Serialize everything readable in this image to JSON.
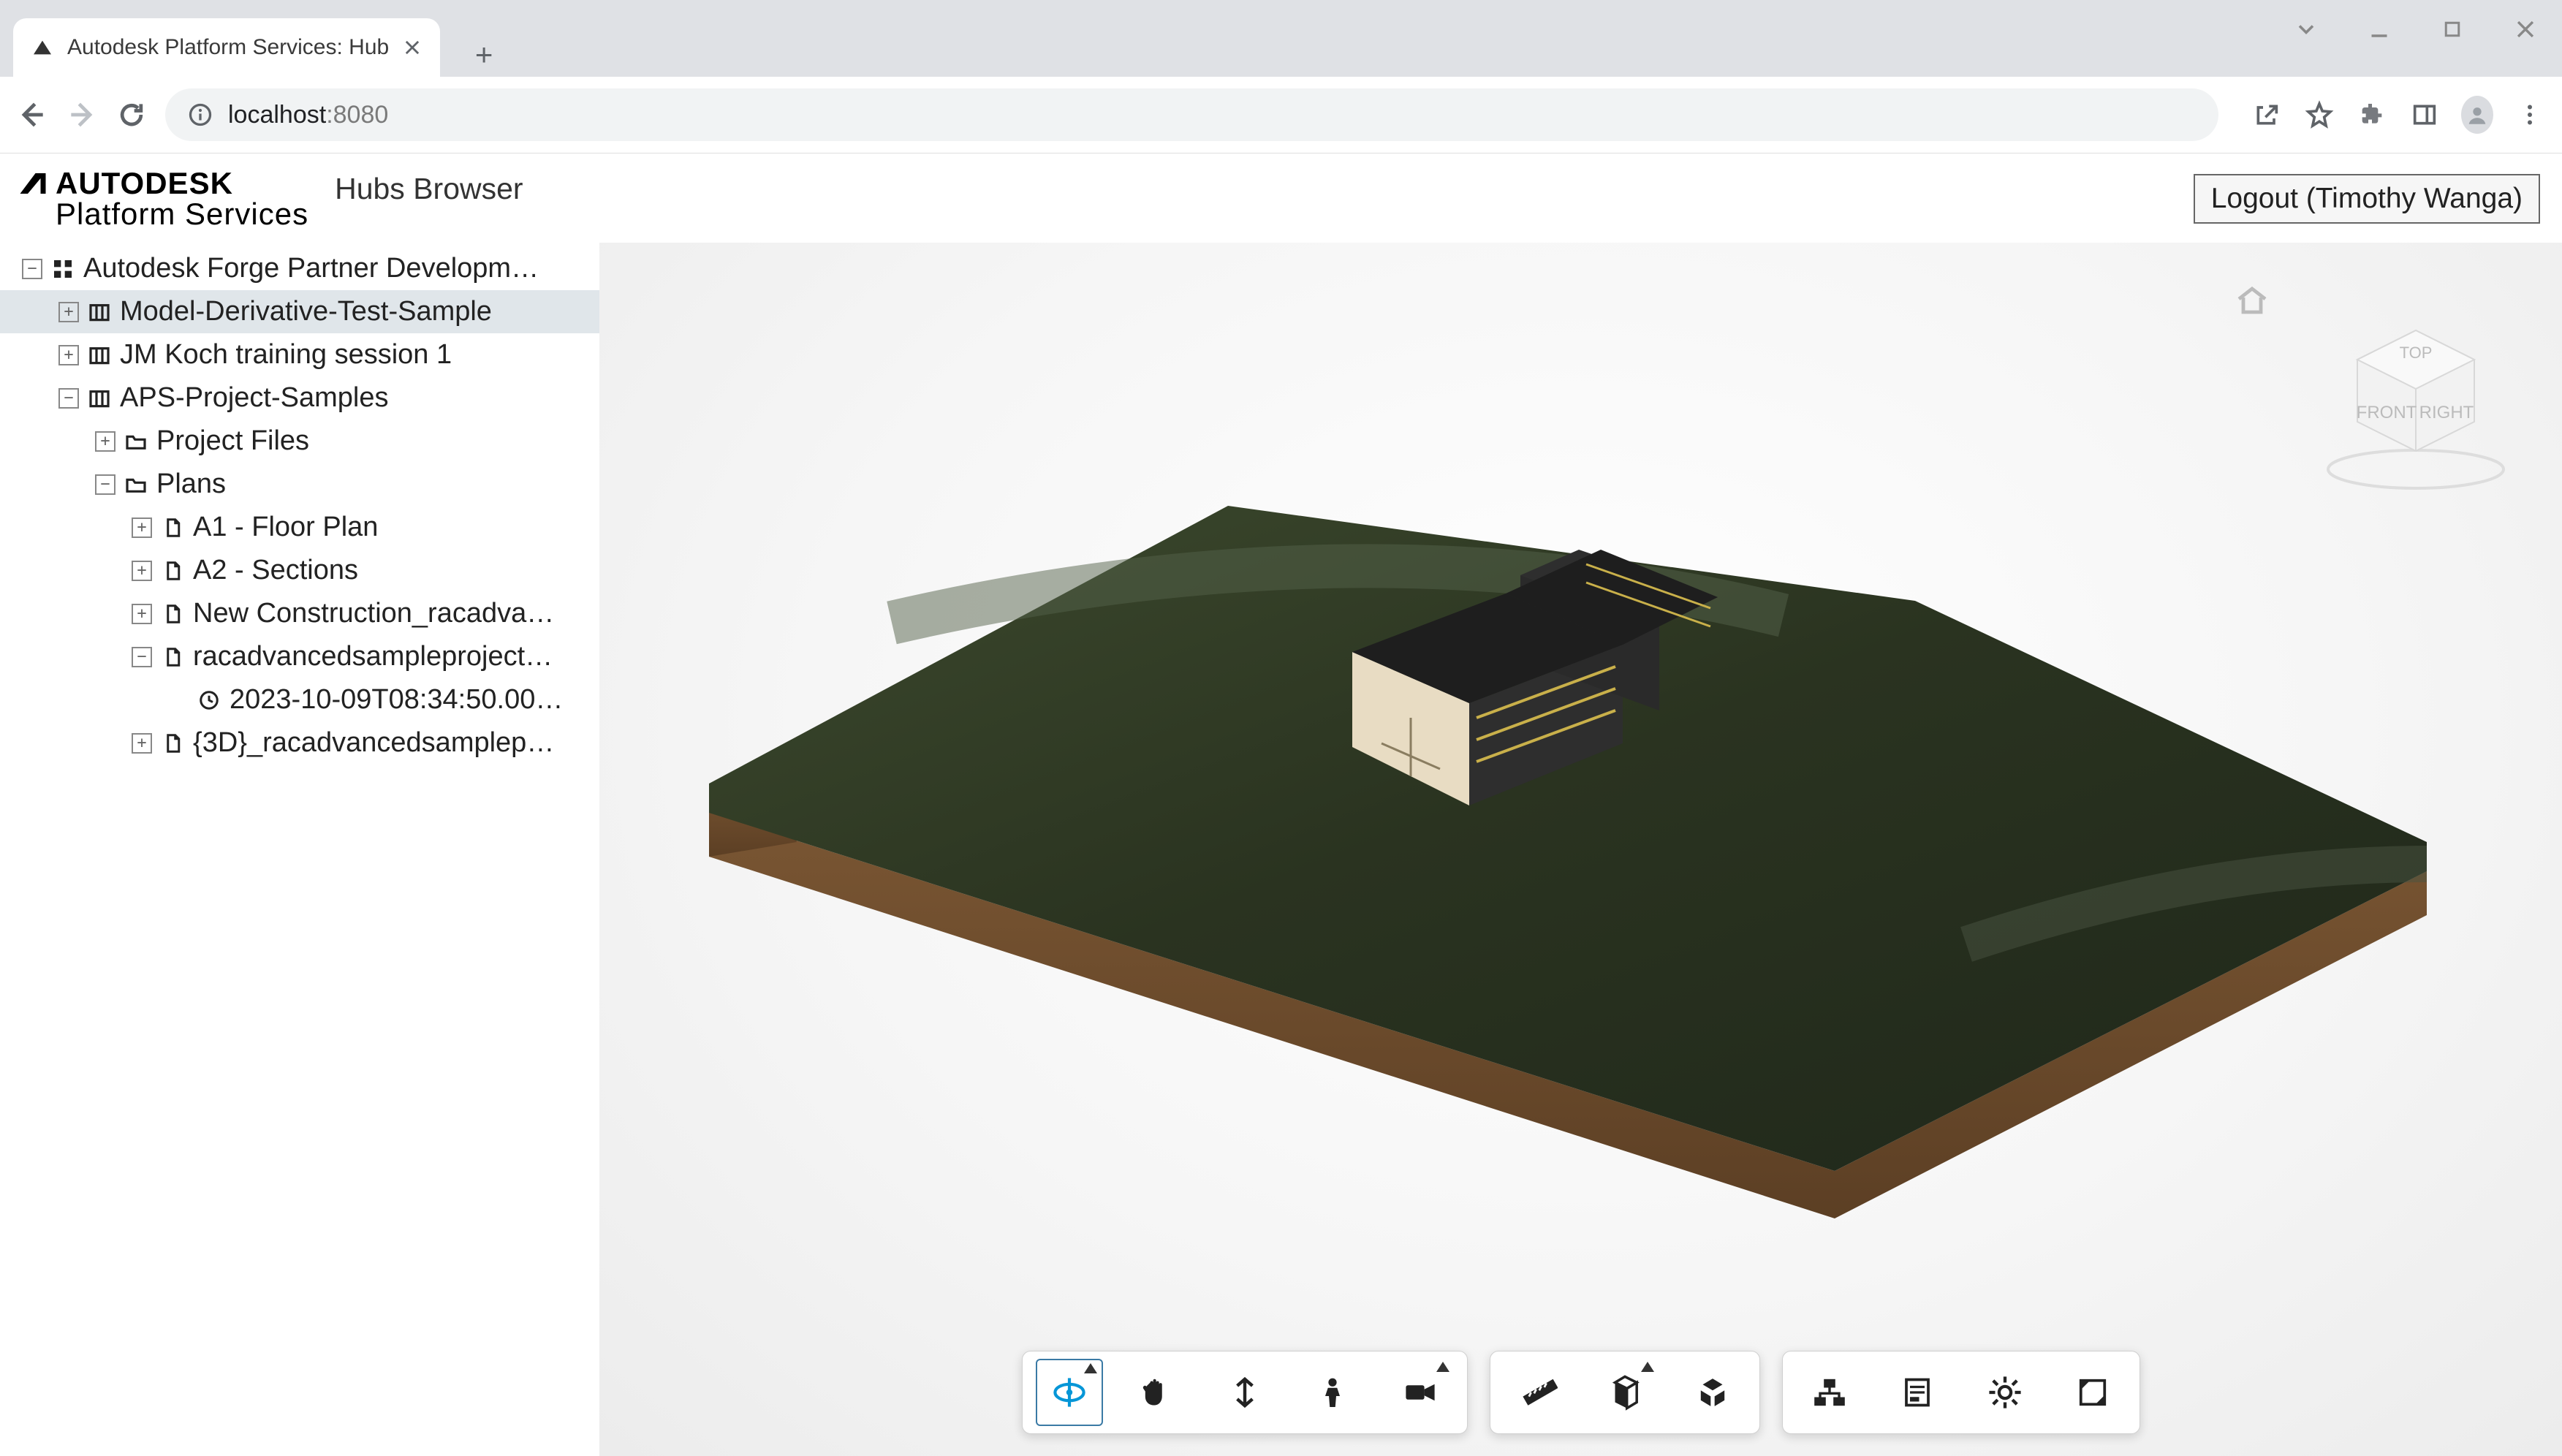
{
  "browser": {
    "tab_title": "Autodesk Platform Services: Hub",
    "url_host": "localhost",
    "url_port": ":8080"
  },
  "header": {
    "brand_line1": "AUTODESK",
    "brand_line2": "Platform Services",
    "title": "Hubs Browser",
    "logout_label": "Logout (Timothy Wanga)"
  },
  "tree": [
    {
      "depth": 0,
      "toggle": "minus",
      "icon": "hub",
      "label": "Autodesk Forge Partner Developm…",
      "sel": false
    },
    {
      "depth": 1,
      "toggle": "plus",
      "icon": "project",
      "label": "Model-Derivative-Test-Sample",
      "sel": true
    },
    {
      "depth": 1,
      "toggle": "plus",
      "icon": "project",
      "label": "JM Koch training session 1",
      "sel": false
    },
    {
      "depth": 1,
      "toggle": "minus",
      "icon": "project",
      "label": "APS-Project-Samples",
      "sel": false
    },
    {
      "depth": 2,
      "toggle": "plus",
      "icon": "folder",
      "label": "Project Files",
      "sel": false
    },
    {
      "depth": 2,
      "toggle": "minus",
      "icon": "folder",
      "label": "Plans",
      "sel": false
    },
    {
      "depth": 3,
      "toggle": "plus",
      "icon": "file",
      "label": "A1 - Floor Plan",
      "sel": false
    },
    {
      "depth": 3,
      "toggle": "plus",
      "icon": "file",
      "label": "A2 - Sections",
      "sel": false
    },
    {
      "depth": 3,
      "toggle": "plus",
      "icon": "file",
      "label": "New Construction_racadva…",
      "sel": false
    },
    {
      "depth": 3,
      "toggle": "minus",
      "icon": "file",
      "label": "racadvancedsampleproject…",
      "sel": false
    },
    {
      "depth": 4,
      "toggle": "none",
      "icon": "clock",
      "label": "2023-10-09T08:34:50.00…",
      "sel": false
    },
    {
      "depth": 3,
      "toggle": "plus",
      "icon": "file",
      "label": "{3D}_racadvancedsamplep…",
      "sel": false
    }
  ],
  "viewcube": {
    "faces": {
      "top": "TOP",
      "front": "FRONT",
      "right": "RIGHT"
    }
  },
  "viewer_tools": {
    "group1": [
      "orbit",
      "pan",
      "dolly",
      "walk",
      "camera"
    ],
    "group2": [
      "measure",
      "section",
      "explode"
    ],
    "group3": [
      "model-browser",
      "properties",
      "settings",
      "fullscreen"
    ],
    "active": "orbit"
  },
  "colors": {
    "terrain_top": "#2f3823",
    "terrain_side": "#6b4a2a",
    "building_wall": "#e8dcc3",
    "building_dark": "#2c2c2c",
    "building_glass_yellow": "#c9b04a"
  }
}
